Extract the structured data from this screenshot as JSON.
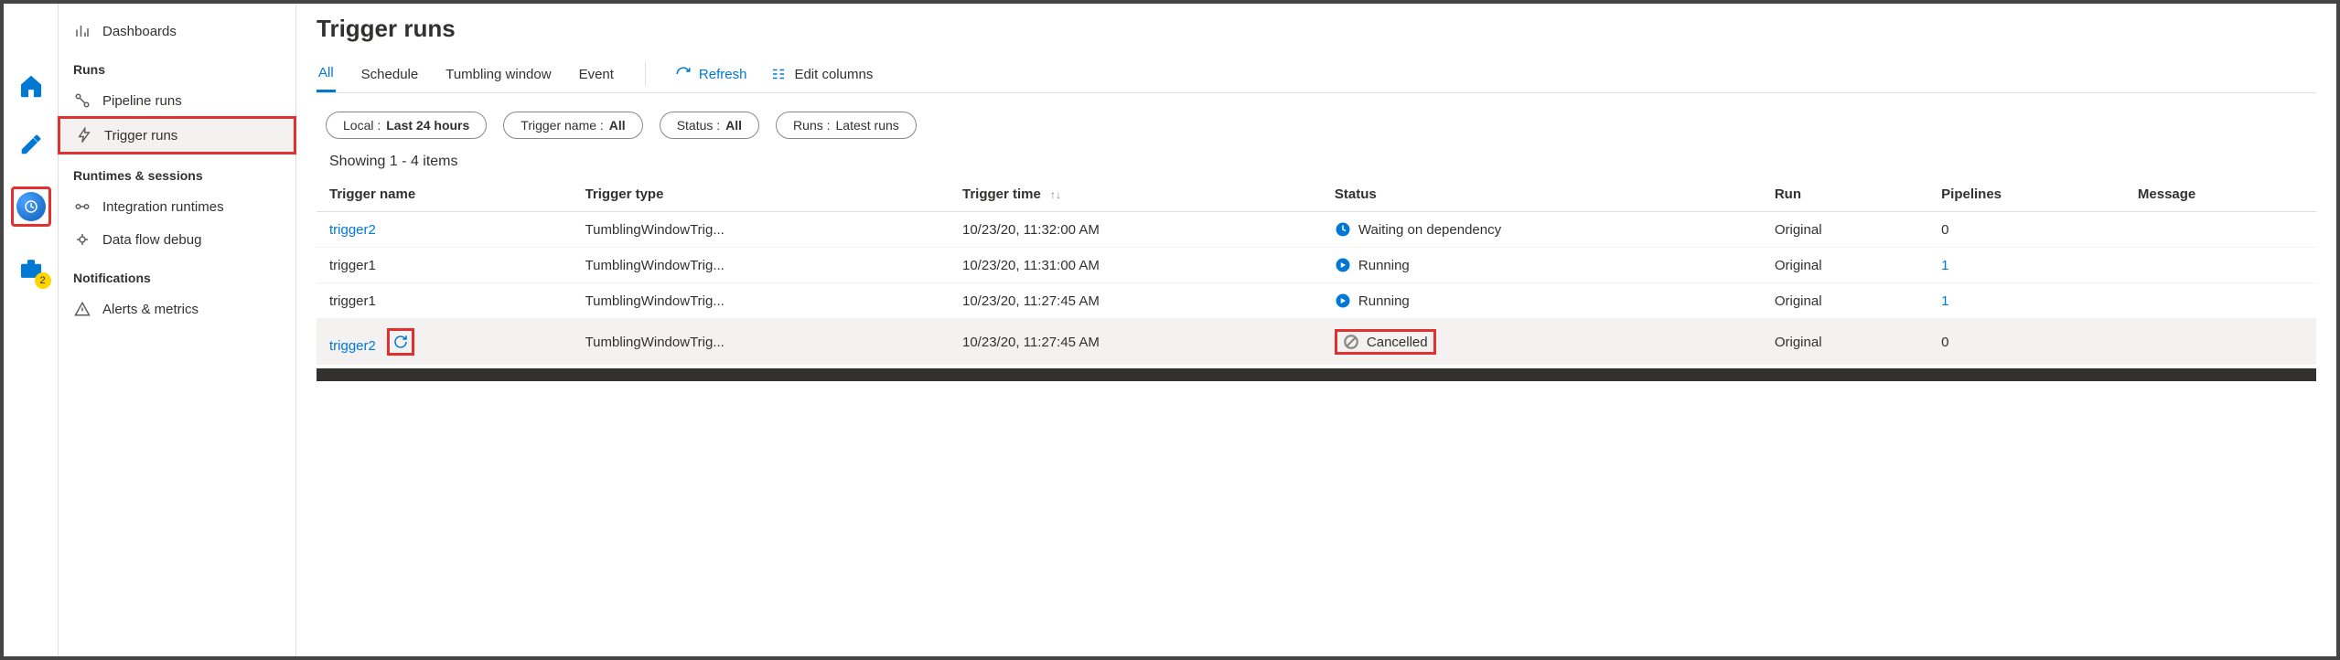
{
  "rail": {
    "badge_count": "2"
  },
  "nav": {
    "dashboards": "Dashboards",
    "runs_head": "Runs",
    "pipeline_runs": "Pipeline runs",
    "trigger_runs": "Trigger runs",
    "runtimes_head": "Runtimes & sessions",
    "integration_runtimes": "Integration runtimes",
    "data_flow_debug": "Data flow debug",
    "notifications_head": "Notifications",
    "alerts_metrics": "Alerts & metrics"
  },
  "main": {
    "title": "Trigger runs",
    "tabs": {
      "all": "All",
      "schedule": "Schedule",
      "tumbling": "Tumbling window",
      "event": "Event"
    },
    "actions": {
      "refresh": "Refresh",
      "edit_columns": "Edit columns"
    },
    "pills": {
      "local_k": "Local :",
      "local_v": "Last 24 hours",
      "trigger_k": "Trigger name :",
      "trigger_v": "All",
      "status_k": "Status :",
      "status_v": "All",
      "runs_k": "Runs :",
      "runs_v": "Latest runs"
    },
    "showing": "Showing 1 - 4 items",
    "columns": {
      "trigger_name": "Trigger name",
      "trigger_type": "Trigger type",
      "trigger_time": "Trigger time",
      "status": "Status",
      "run": "Run",
      "pipelines": "Pipelines",
      "message": "Message"
    },
    "rows": [
      {
        "name": "trigger2",
        "name_link": true,
        "type": "TumblingWindowTrig...",
        "time": "10/23/20, 11:32:00 AM",
        "status": "Waiting on dependency",
        "status_kind": "waiting",
        "run": "Original",
        "pipelines": "0",
        "pipelines_link": false
      },
      {
        "name": "trigger1",
        "name_link": false,
        "type": "TumblingWindowTrig...",
        "time": "10/23/20, 11:31:00 AM",
        "status": "Running",
        "status_kind": "running",
        "run": "Original",
        "pipelines": "1",
        "pipelines_link": true
      },
      {
        "name": "trigger1",
        "name_link": false,
        "type": "TumblingWindowTrig...",
        "time": "10/23/20, 11:27:45 AM",
        "status": "Running",
        "status_kind": "running",
        "run": "Original",
        "pipelines": "1",
        "pipelines_link": true
      },
      {
        "name": "trigger2",
        "name_link": true,
        "type": "TumblingWindowTrig...",
        "time": "10/23/20, 11:27:45 AM",
        "status": "Cancelled",
        "status_kind": "cancelled",
        "run": "Original",
        "pipelines": "0",
        "pipelines_link": false
      }
    ]
  }
}
